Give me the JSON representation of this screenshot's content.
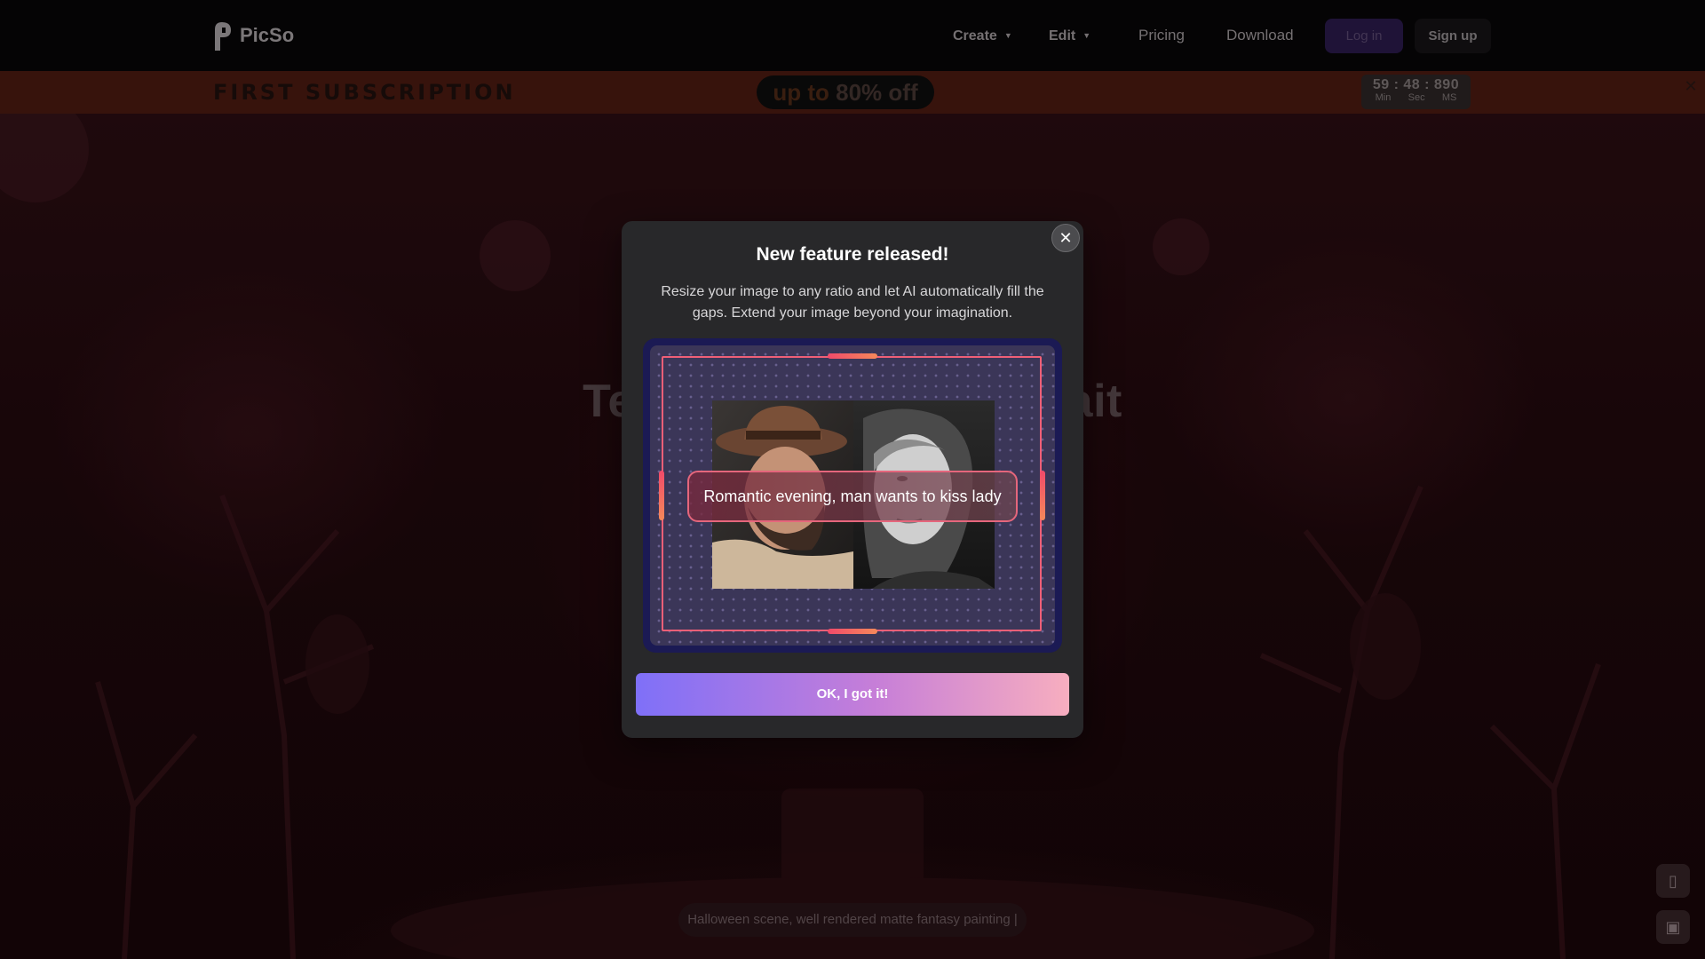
{
  "nav": {
    "brand": "PicSo",
    "items": [
      {
        "label": "Create",
        "has_caret": true
      },
      {
        "label": "Edit",
        "has_caret": true
      },
      {
        "label": "Pricing",
        "has_caret": false
      },
      {
        "label": "Download",
        "has_caret": false
      }
    ],
    "login_label": "Log in",
    "signup_label": "Sign up"
  },
  "promo": {
    "title": "FIRST SUBSCRIPTION",
    "discount_prefix": "up to",
    "discount_value": "80% off",
    "timer": {
      "min": "59",
      "sec": "48",
      "ms": "890",
      "unit_min": "Min",
      "unit_sec": "Sec",
      "unit_ms": "MS"
    },
    "close_icon": "close-icon"
  },
  "hero": {
    "title": "Text to Image AI Portrait",
    "prompt_placeholder": "Halloween scene, well rendered matte fantasy painting |"
  },
  "side_buttons": [
    {
      "icon": "app-download-icon",
      "label": "APP"
    },
    {
      "icon": "chat-icon",
      "label": ""
    }
  ],
  "modal": {
    "title": "New feature released!",
    "description": "Resize your image to any ratio and let AI automatically fill the gaps. Extend your image beyond your imagination.",
    "prompt_text": "Romantic evening, man wants to kiss lady",
    "ok_label": "OK, I got it!",
    "close_glyph": "✕"
  },
  "colors": {
    "accent_gradient_start": "#7f70f8",
    "accent_gradient_end": "#f7aebf",
    "frame": "#ef5f77",
    "modal_bg": "#28282a"
  }
}
